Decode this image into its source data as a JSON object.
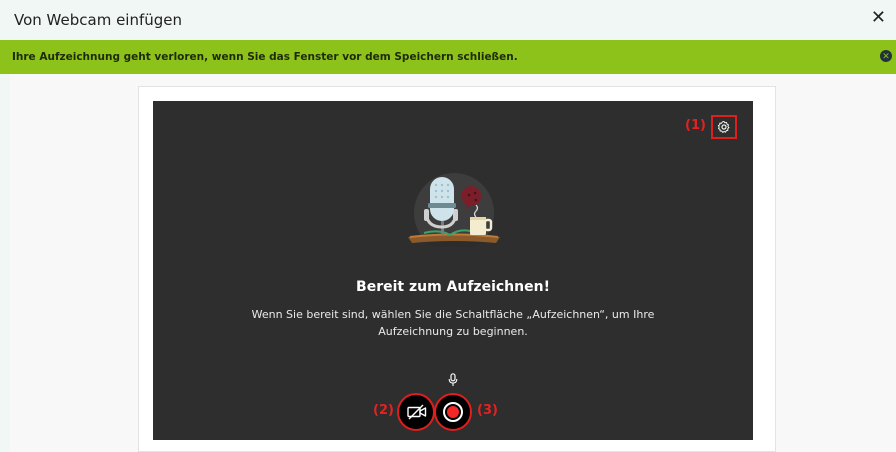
{
  "dialog": {
    "title": "Von Webcam einfügen",
    "close_symbol": "✕"
  },
  "banner": {
    "text": "Ihre Aufzeichnung geht verloren, wenn Sie das Fenster vor dem Speichern schließen.",
    "color": "#8dc21b",
    "close_symbol": "✕"
  },
  "recorder": {
    "heading": "Bereit zum Aufzeichnen!",
    "description": "Wenn Sie bereit sind, wählen Sie die Schaltfläche „Aufzeichnen“, um Ihre Aufzeichnung zu beginnen.",
    "annotations": {
      "settings": "(1)",
      "camera": "(2)",
      "record": "(3)"
    },
    "icons": [
      "gear-icon",
      "microphone-icon",
      "camera-off-icon",
      "record-icon"
    ],
    "annotation_color": "#e32222"
  }
}
